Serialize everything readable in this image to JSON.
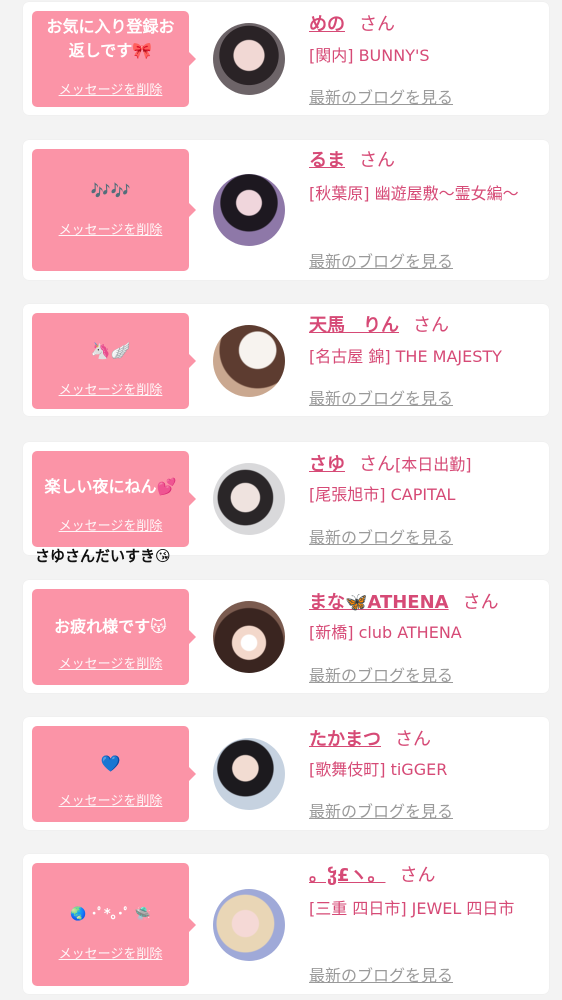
{
  "common": {
    "delete_label": "メッセージを削除",
    "blog_label": "最新のブログを見る",
    "san": "さん"
  },
  "colors": {
    "bubble": "#fb94a7",
    "accent": "#d64a76",
    "muted": "#9a9a9a",
    "background": "#f3f3f3"
  },
  "entries": [
    {
      "message": "お気に入り登録お\n返しです🎀",
      "name": "めの",
      "status": "",
      "shop": "[関内] BUNNY'S"
    },
    {
      "message": "🎶🎶",
      "name": "るま",
      "status": "",
      "shop": "[秋葉原] 幽遊屋敷〜霊女編〜"
    },
    {
      "message": "🦄🪽",
      "name": "天馬　りん",
      "status": "",
      "shop": "[名古屋 錦] THE MAJESTY"
    },
    {
      "message": "楽しい夜にねん💕",
      "overflow": "さゆさんだいすき😘",
      "name": "さゆ",
      "status": "[本日出勤]",
      "shop": "[尾張旭市] CAPITAL"
    },
    {
      "message": "お疲れ様です😽",
      "name": "まな🦋ATHENA",
      "status": "",
      "shop": "[新橋] club ATHENA"
    },
    {
      "message": "💙",
      "name": "たかまつ",
      "status": "",
      "shop": "[歌舞伎町] tiGGER"
    },
    {
      "message": "🌏 ･ﾟ*｡･ﾟ 🛸",
      "name": "。ჴ£ヽ。",
      "status": "",
      "shop": "[三重 四日市] JEWEL 四日市"
    }
  ]
}
